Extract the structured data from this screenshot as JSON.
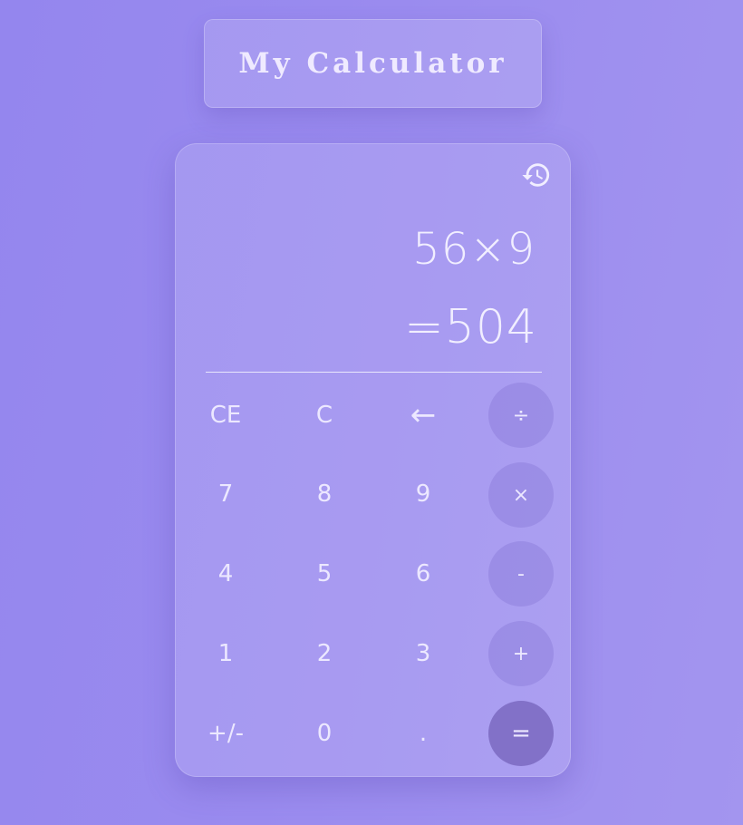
{
  "header": {
    "title": "My Calculator"
  },
  "display": {
    "expression": "56×9",
    "result": "=504"
  },
  "icons": {
    "history": "history-icon"
  },
  "keypad": {
    "row1": [
      "CE",
      "C",
      "←",
      "÷"
    ],
    "row2": [
      "7",
      "8",
      "9",
      "×"
    ],
    "row3": [
      "4",
      "5",
      "6",
      "-"
    ],
    "row4": [
      "1",
      "2",
      "3",
      "+"
    ],
    "row5": [
      "+/-",
      "0",
      ".",
      "="
    ]
  },
  "colors": {
    "background": "#9a8bef",
    "card": "#a89cf0",
    "operator_key": "#9c8fe0",
    "equals_key": "#8779c6",
    "text": "#eeeaff"
  }
}
